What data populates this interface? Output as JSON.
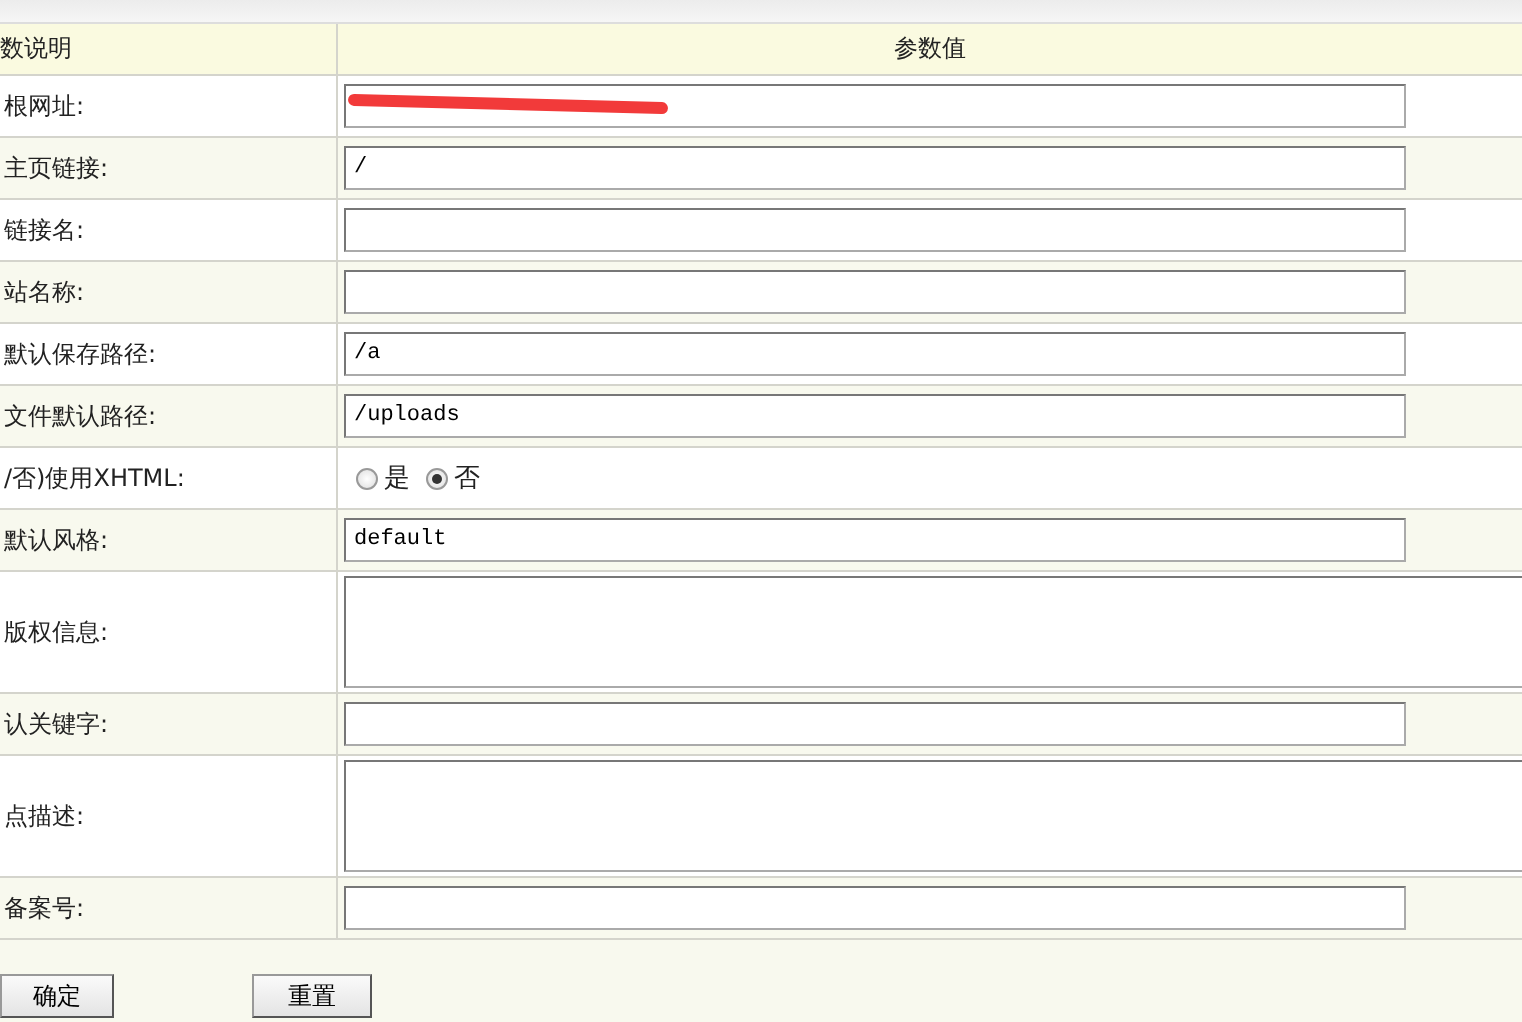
{
  "table": {
    "columns": [
      "数说明",
      "参数值"
    ],
    "rows": [
      {
        "kind": "text",
        "label": "根网址:",
        "value": "",
        "redacted": true
      },
      {
        "kind": "text",
        "label": "主页链接:",
        "value": "/"
      },
      {
        "kind": "text",
        "label": "链接名:",
        "value": ""
      },
      {
        "kind": "text",
        "label": "站名称:",
        "value": ""
      },
      {
        "kind": "text",
        "label": "默认保存路径:",
        "value": "/a"
      },
      {
        "kind": "text",
        "label": "文件默认路径:",
        "value": "/uploads"
      },
      {
        "kind": "radio",
        "label": "/否)使用XHTML:",
        "options": [
          {
            "label": "是",
            "selected": false
          },
          {
            "label": "否",
            "selected": true
          }
        ]
      },
      {
        "kind": "text",
        "label": "默认风格:",
        "value": "default"
      },
      {
        "kind": "textarea",
        "label": "版权信息:",
        "value": ""
      },
      {
        "kind": "text",
        "label": "认关键字:",
        "value": ""
      },
      {
        "kind": "textarea",
        "label": "点描述:",
        "value": ""
      },
      {
        "kind": "text",
        "label": "备案号:",
        "value": ""
      }
    ]
  },
  "buttons": [
    "确定",
    "重置"
  ]
}
